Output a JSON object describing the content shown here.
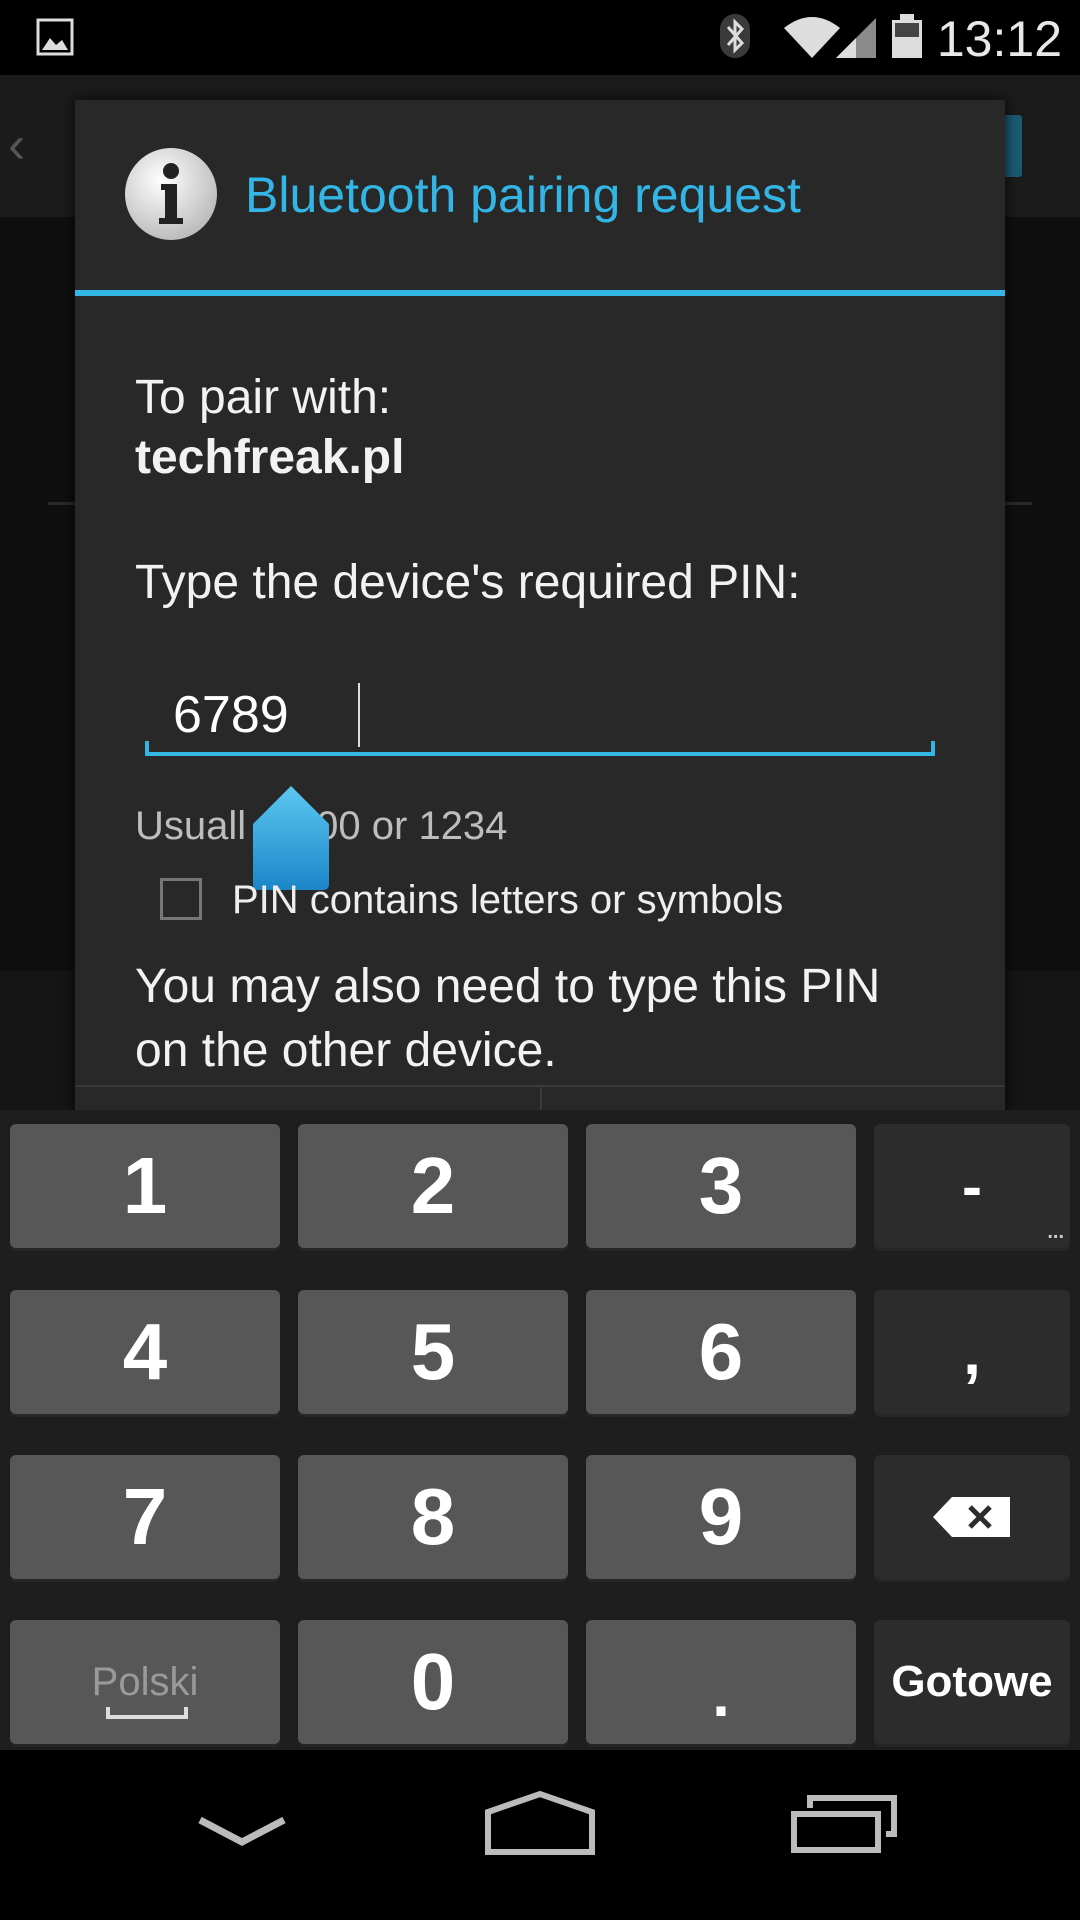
{
  "status_bar": {
    "time": "13:12",
    "icons": [
      "gallery-notification-icon",
      "bluetooth-icon",
      "wifi-icon",
      "signal-icon",
      "battery-icon"
    ]
  },
  "dialog": {
    "title": "Bluetooth pairing request",
    "pair_label": "To pair with:",
    "device_name": "techfreak.pl",
    "pin_prompt": "Type the device's required PIN:",
    "pin_value": "6789",
    "hint_left": "Usuall",
    "hint_right": "00 or 1234",
    "checkbox_label": "PIN contains letters or symbols",
    "checkbox_checked": false,
    "note": "You may also need to type this PIN on the other device."
  },
  "keyboard": {
    "rows": [
      [
        {
          "label": "1"
        },
        {
          "label": "2"
        },
        {
          "label": "3"
        },
        {
          "label": "-"
        }
      ],
      [
        {
          "label": "4"
        },
        {
          "label": "5"
        },
        {
          "label": "6"
        },
        {
          "label": ","
        }
      ],
      [
        {
          "label": "7"
        },
        {
          "label": "8"
        },
        {
          "label": "9"
        },
        {
          "label": "backspace"
        }
      ],
      [
        {
          "label": "Polski"
        },
        {
          "label": "0"
        },
        {
          "label": "."
        },
        {
          "label": "Gotowe"
        }
      ]
    ],
    "more_indicator": "..."
  },
  "colors": {
    "accent": "#33b5e5",
    "dialog_bg": "#282828",
    "key_bg": "#575757",
    "key_dark_bg": "#2c2c2c"
  }
}
